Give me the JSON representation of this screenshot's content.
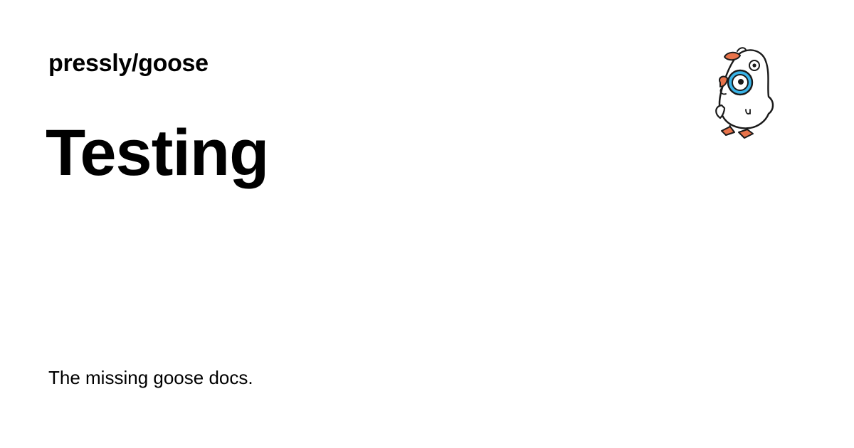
{
  "header": {
    "repo_name": "pressly/goose"
  },
  "main": {
    "title": "Testing",
    "tagline": "The missing goose docs."
  },
  "logo": {
    "icon": "goose-mascot-icon",
    "colors": {
      "outline": "#1a1a1a",
      "body": "#ffffff",
      "beak_feet": "#e8734a",
      "lens": "#3ab4e8"
    }
  }
}
